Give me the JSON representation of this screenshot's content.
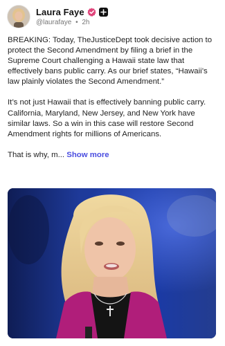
{
  "post": {
    "author": {
      "display_name": "Laura Faye",
      "handle": "@laurafaye",
      "time": "2h",
      "separator": "•",
      "verified_icon": "verified-badge-icon",
      "follow_icon": "plus-icon"
    },
    "paragraphs": [
      "BREAKING: Today, TheJusticeDept took decisive action to protect the Second Amendment by filing a brief in the Supreme Court challenging a Hawaii state law that effectively bans public carry.  As our brief states, “Hawaii’s law plainly violates the Second Amendment.”",
      "It’s not just Hawaii that is effectively banning public carry.  California, Maryland, New Jersey, and New York have similar laws.  So a win in this case will restore Second Amendment rights for millions of Americans."
    ],
    "truncated_text": "That is why, m...",
    "show_more_label": "Show more",
    "colors": {
      "accent": "#4a4de0",
      "verified_badge": "#e0457b",
      "text": "#222222",
      "muted": "#777777"
    }
  }
}
